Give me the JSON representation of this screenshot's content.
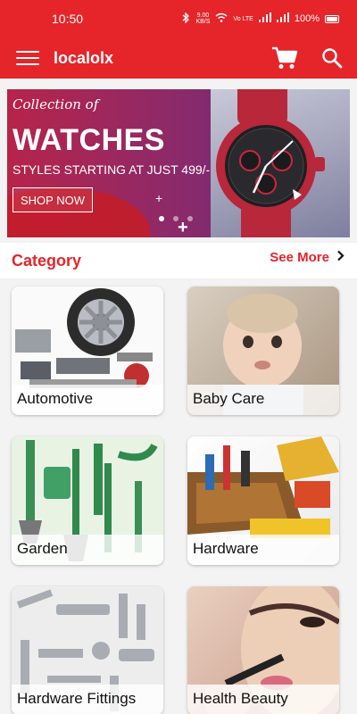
{
  "status_bar": {
    "time": "10:50",
    "network_speed": "9.00",
    "speed_unit": "KB/S",
    "sim_labels": "Vo LTE",
    "battery": "100%"
  },
  "app_bar": {
    "title": "localolx",
    "icons": [
      "menu-icon",
      "cart-icon",
      "search-icon"
    ]
  },
  "banner": {
    "script_text": "Collection of",
    "title": "WATCHES",
    "subtitle": "STYLES STARTING AT JUST 499/-",
    "cta": "SHOP NOW",
    "slide_count": 3,
    "active_slide": 1
  },
  "category": {
    "title": "Category",
    "see_more": "See More",
    "items": [
      {
        "label": "Automotive"
      },
      {
        "label": "Baby Care"
      },
      {
        "label": "Garden"
      },
      {
        "label": "Hardware"
      },
      {
        "label": "Hardware Fittings"
      },
      {
        "label": "Health  Beauty"
      }
    ]
  },
  "colors": {
    "brand": "#e5252a",
    "background": "#f3f3f3"
  }
}
